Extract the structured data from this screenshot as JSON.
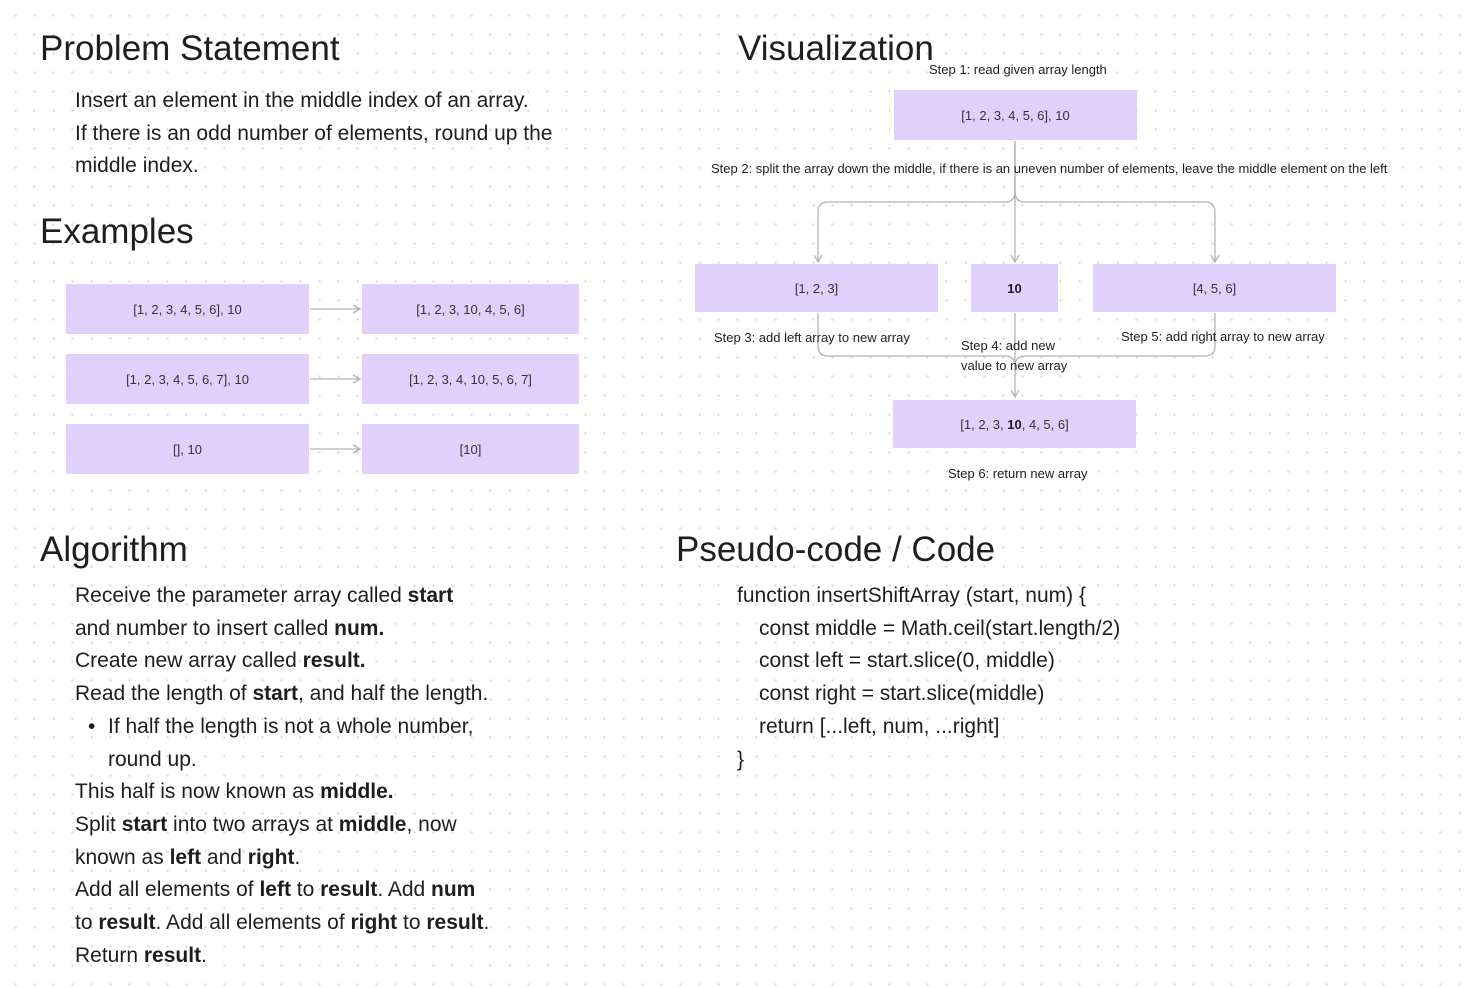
{
  "problem": {
    "heading": "Problem Statement",
    "lines": [
      "Insert an element in the middle index of an array.",
      "If there is an odd number of elements, round up the",
      "middle index."
    ]
  },
  "examples": {
    "heading": "Examples",
    "rows": [
      {
        "input": "[1, 2, 3, 4, 5, 6], 10",
        "output": "[1, 2, 3, 10, 4, 5, 6]"
      },
      {
        "input": "[1, 2, 3, 4, 5, 6, 7], 10",
        "output": "[1, 2, 3, 4, 10, 5, 6, 7]"
      },
      {
        "input": "[], 10",
        "output": "[10]"
      }
    ]
  },
  "visualization": {
    "heading": "Visualization",
    "step1": "Step 1: read given array length",
    "start_box": "[1, 2, 3, 4, 5, 6], 10",
    "step2": "Step 2: split the array down the middle, if there is an  uneven number of elements, leave the middle element on the left",
    "left_box": "[1, 2, 3]",
    "num_box": "10",
    "right_box": "[4, 5, 6]",
    "step3": "Step 3: add left array to new array",
    "step4_line1": "Step 4: add new",
    "step4_line2": "value to new array",
    "step5": "Step 5: add right array to new array",
    "result_before": "[1, 2, 3, ",
    "result_bold": "10",
    "result_after": ", 4, 5, 6]",
    "step6": "Step 6: return new array"
  },
  "algorithm": {
    "heading": "Algorithm",
    "l1_a": "Receive the parameter array called ",
    "l1_b": "start",
    "l2_a": "and number to insert called ",
    "l2_b": "num.",
    "l3_a": "Create new array called ",
    "l3_b": "result.",
    "l4_a": "Read the length of ",
    "l4_b": "start",
    "l4_c": ", and half the length.",
    "bullet": "•",
    "b1": "If half the length is not a whole number,",
    "b2": "round up.",
    "l5_a": "This half is now known as ",
    "l5_b": "middle.",
    "l6_a": "Split ",
    "l6_b": "start",
    "l6_c": " into two arrays at ",
    "l6_d": "middle",
    "l6_e": ", now",
    "l7_a": "known as ",
    "l7_b": "left",
    "l7_c": " and ",
    "l7_d": "right",
    "l7_e": ".",
    "l8_a": "Add all elements of ",
    "l8_b": "left",
    "l8_c": " to ",
    "l8_d": "result",
    "l8_e": ". Add ",
    "l8_f": "num",
    "l9_a": "to ",
    "l9_b": "result",
    "l9_c": ". Add all elements of ",
    "l9_d": "right",
    "l9_e": " to ",
    "l9_f": "result",
    "l9_g": ".",
    "l10_a": "Return ",
    "l10_b": "result",
    "l10_c": "."
  },
  "code": {
    "heading": "Pseudo-code / Code",
    "lines": [
      "function insertShiftArray (start, num) {",
      "const middle = Math.ceil(start.length/2)",
      "const left = start.slice(0, middle)",
      "const right = start.slice(middle)",
      "return [...left, num, ...right]",
      "}"
    ]
  },
  "colors": {
    "box_fill": "#e0d0fb",
    "line": "#b3b3b3",
    "text": "#1e1e1e"
  }
}
